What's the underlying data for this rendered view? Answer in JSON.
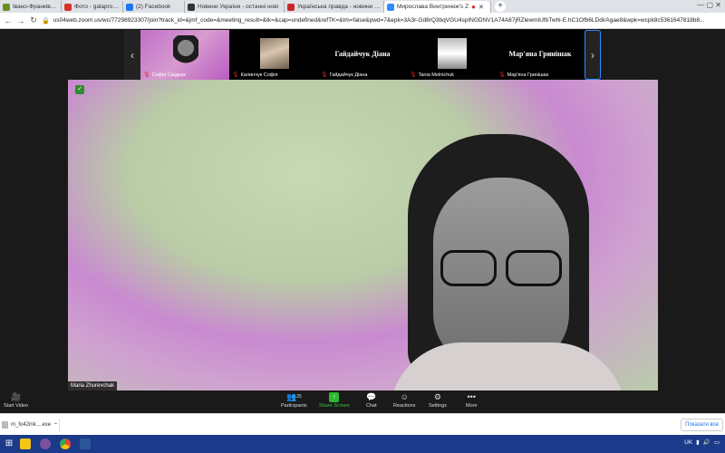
{
  "browser": {
    "tabs": [
      {
        "label": "Івано-Франківський і",
        "favicon_color": "#6b8e23"
      },
      {
        "label": "Фото - galaprotsiv@gmail.com",
        "favicon_color": "#d93025"
      },
      {
        "label": "(2) Facebook",
        "favicon_color": "#1877f2"
      },
      {
        "label": "Новини України - останні нові",
        "favicon_color": "#333333"
      },
      {
        "label": "Українська правда - новини он",
        "favicon_color": "#c62828"
      },
      {
        "label": "Мирослава Винтринюк's Z",
        "favicon_color": "#2d8cff",
        "active": true
      }
    ],
    "new_tab": "+",
    "window_controls": "—  ▢  ✕",
    "url": "us04web.zoom.us/wc/77298923307/join?track_id=&jmf_code=&meeting_result=&tk=&cap=undefined&refTK=&tm=false&pwd=7&epk=3A3r-Gd8rQ3bqVGU4spINGDNV1A74A87jRZlewmiUfbTwhl-E.hC1Ofb6LDdirAgae8&wpk=wcpk8c5361647818b8..."
  },
  "zoom": {
    "gallery": [
      {
        "name": "Софія Свідрак",
        "muted": true,
        "type": "video-selected"
      },
      {
        "name": "Калинчук Софія",
        "muted": true,
        "type": "photo1"
      },
      {
        "name": "Гайдайчук Діана",
        "muted": true,
        "type": "text",
        "display_name": "Гайдайчук Діана"
      },
      {
        "name": "Tania Melnichuk",
        "muted": true,
        "type": "photo2"
      },
      {
        "name": "Мар'яна Гринішак",
        "muted": true,
        "type": "text",
        "display_name": "Мар'яна Гринішак"
      }
    ],
    "main_speaker_name": "Maria Zhurevchak",
    "toolbar": {
      "start_video": "Start Video",
      "participants": "Participants",
      "participants_count": "25",
      "share_screen": "Share Screen",
      "chat": "Chat",
      "reactions": "Reactions",
      "settings": "Settings",
      "more": "More"
    }
  },
  "downloads": {
    "item": "m_fo42ink....exe",
    "show_all": "Показати все"
  },
  "taskbar": {
    "lang": "UK",
    "apps": [
      {
        "name": "folder",
        "color": "#f5c518"
      },
      {
        "name": "viber",
        "color": "#7b519d"
      },
      {
        "name": "chrome",
        "color": "#34a853"
      },
      {
        "name": "word",
        "color": "#2b579a"
      }
    ]
  }
}
